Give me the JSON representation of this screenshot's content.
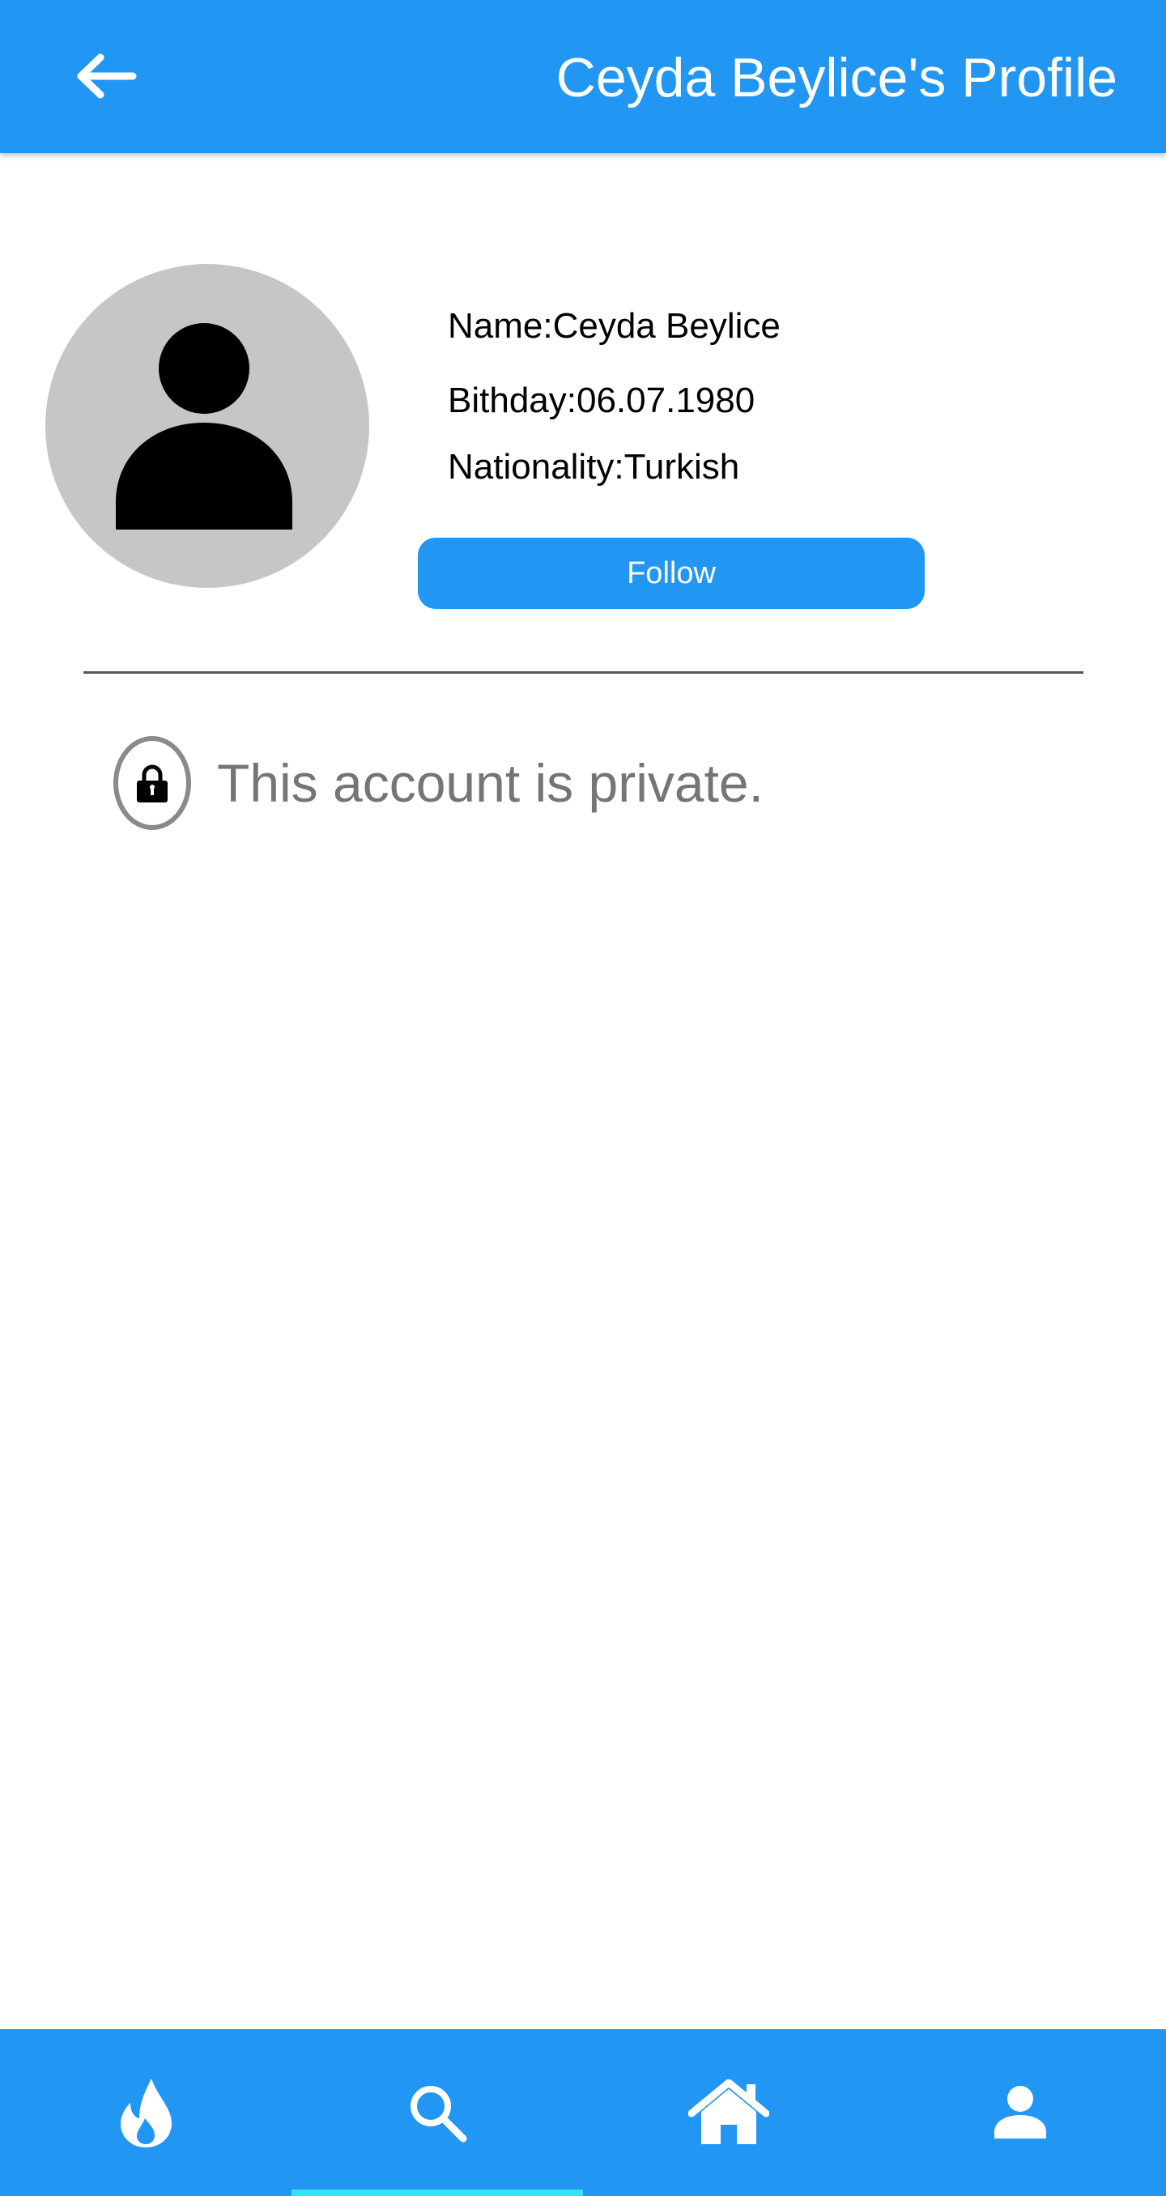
{
  "header": {
    "title": "Ceyda Beylice's Profile",
    "back_icon": "arrow-left-icon",
    "background_color": "#2196f3"
  },
  "profile": {
    "avatar_icon": "person-icon",
    "name_line": "Name:Ceyda Beylice",
    "birthday_line": "Bithday:06.07.1980",
    "nationality_line": "Nationality:Turkish",
    "follow_label": "Follow"
  },
  "privacy": {
    "icon": "lock-icon",
    "message": "This account is private."
  },
  "bottom_nav": {
    "items": [
      {
        "icon": "flame-icon"
      },
      {
        "icon": "search-icon",
        "selected": true
      },
      {
        "icon": "home-icon"
      },
      {
        "icon": "person-icon"
      }
    ],
    "indicator_color": "#34e6f4"
  }
}
